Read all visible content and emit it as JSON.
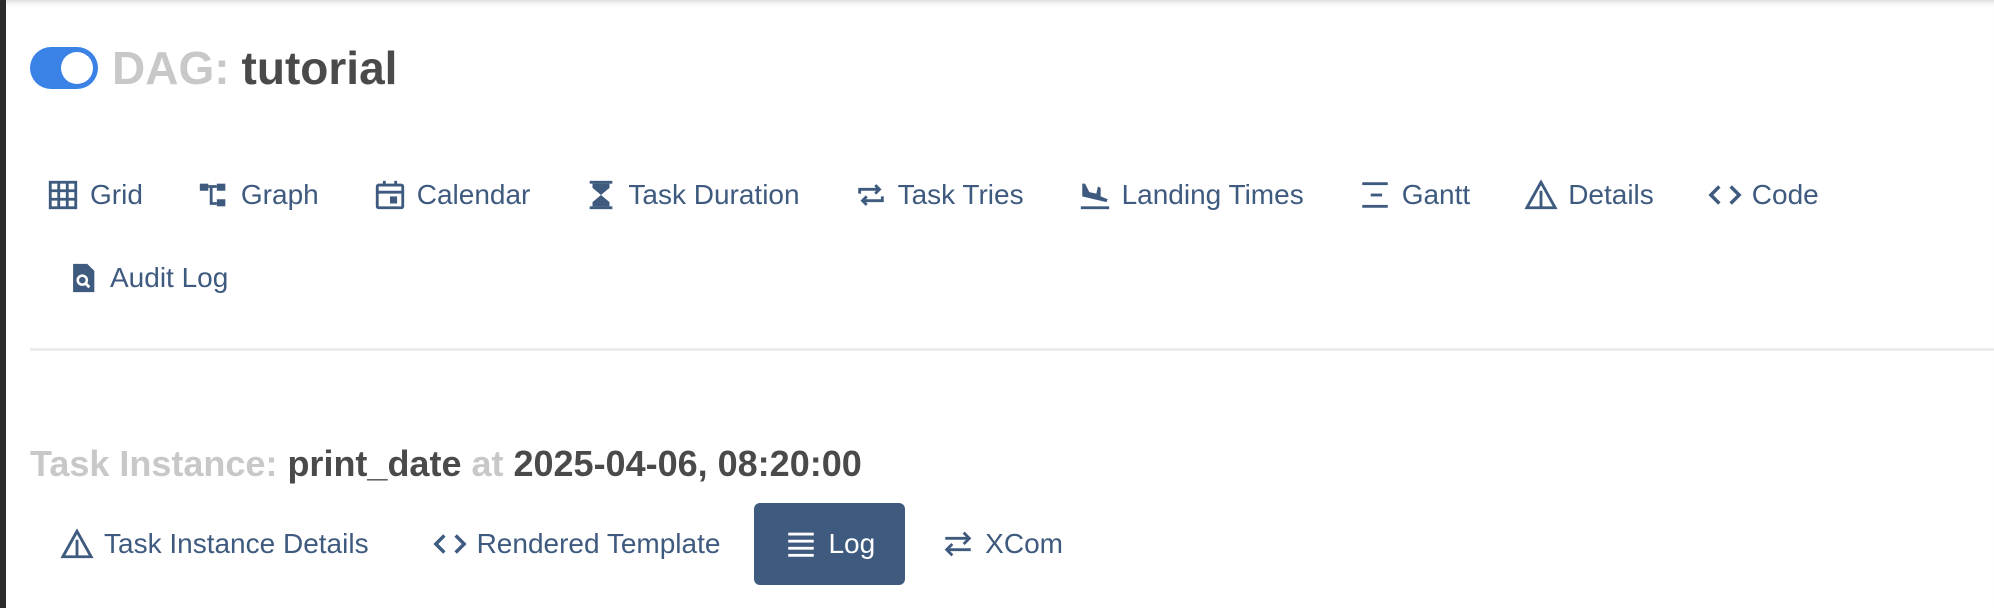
{
  "dag": {
    "prefix": "DAG:",
    "name": "tutorial",
    "paused": false
  },
  "nav": {
    "items": [
      {
        "label": "Grid",
        "icon": "grid-icon"
      },
      {
        "label": "Graph",
        "icon": "graph-icon"
      },
      {
        "label": "Calendar",
        "icon": "calendar-icon"
      },
      {
        "label": "Task Duration",
        "icon": "hourglass-icon"
      },
      {
        "label": "Task Tries",
        "icon": "repeat-icon"
      },
      {
        "label": "Landing Times",
        "icon": "plane-landing-icon"
      },
      {
        "label": "Gantt",
        "icon": "gantt-icon"
      },
      {
        "label": "Details",
        "icon": "warning-triangle-icon"
      },
      {
        "label": "Code",
        "icon": "code-icon"
      },
      {
        "label": "Audit Log",
        "icon": "file-search-icon"
      }
    ]
  },
  "task_instance": {
    "prefix": "Task Instance:",
    "task_id": "print_date",
    "at": "at",
    "date": "2025-04-06, 08:20:00",
    "tabs": [
      {
        "label": "Task Instance Details",
        "icon": "warning-triangle-icon"
      },
      {
        "label": "Rendered Template",
        "icon": "code-icon"
      },
      {
        "label": "Log",
        "icon": "list-lines-icon",
        "active": true
      },
      {
        "label": "XCom",
        "icon": "swap-icon"
      }
    ]
  },
  "colors": {
    "accent": "#3e5a7e",
    "toggle_on": "#3b82e6",
    "muted_text": "#c8c8c8",
    "strong_text": "#4a4a4a"
  }
}
